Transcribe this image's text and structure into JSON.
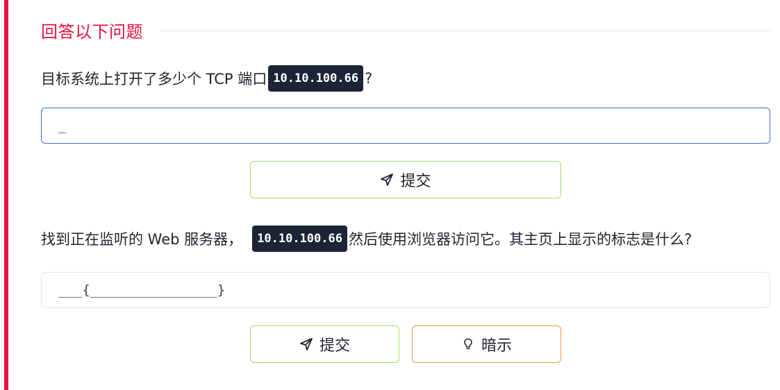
{
  "section": {
    "title": "回答以下问题"
  },
  "questions": [
    {
      "text_before": "目标系统上打开了多少个 TCP 端口",
      "ip": "10.10.100.66",
      "text_after": "?",
      "answer_value": "_",
      "submit_label": "提交"
    },
    {
      "text_before": "找到正在监听的 Web 服务器，",
      "ip": "10.10.100.66",
      "text_after": "然后使用浏览器访问它。其主页上显示的标志是什么?",
      "answer_value": "___{________________}",
      "submit_label": "提交",
      "hint_label": "暗示"
    }
  ],
  "icons": {
    "submit": "paper-plane-icon",
    "hint": "lightbulb-icon"
  },
  "colors": {
    "accent": "#e8113f",
    "badge_bg": "#1d2436",
    "submit_border": "#a6dd5c",
    "hint_border": "#eb9a3a",
    "active_field_border": "#3a6fd0"
  }
}
